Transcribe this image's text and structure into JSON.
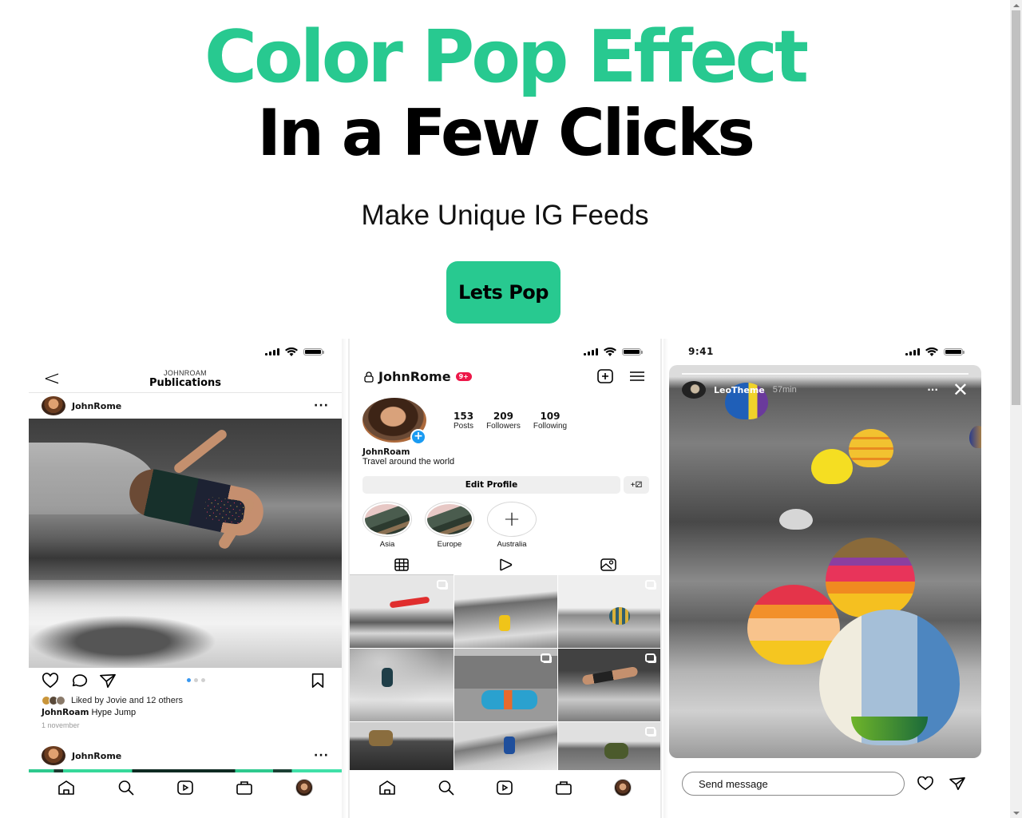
{
  "hero": {
    "title_line1": "Color Pop Effect",
    "title_line2": "In a Few Clicks",
    "subtitle": "Make Unique IG Feeds",
    "cta_label": "Lets Pop"
  },
  "colors": {
    "accent": "#28c990",
    "badge": "#ed1849",
    "add_story": "#1a9bf2",
    "active_dot": "#3897f0"
  },
  "status_bar": {
    "time": "9:41",
    "icons": [
      "signal-icon",
      "wifi-icon",
      "battery-icon"
    ]
  },
  "feed_screen": {
    "nav": {
      "back_icon": "chevron-left-icon",
      "account": "JOHNROAM",
      "title": "Publications"
    },
    "post": {
      "username": "JohnRome",
      "more_icon": "more-horizontal-icon",
      "action_icons": [
        "heart-icon",
        "comment-icon",
        "send-icon",
        "bookmark-icon"
      ],
      "carousel": {
        "count": 3,
        "active": 1
      },
      "liked_by": "Liked by Jovie and 12 others",
      "caption_user": "JohnRoam",
      "caption_text": "Hype Jump",
      "date": "1 november"
    },
    "next_post": {
      "username": "JohnRome"
    }
  },
  "profile_screen": {
    "username": "JohnRome",
    "notification_badge": "9+",
    "header_icons": [
      "lock-icon",
      "add-post-icon",
      "menu-icon"
    ],
    "stats": [
      {
        "value": "153",
        "label": "Posts"
      },
      {
        "value": "209",
        "label": "Followers"
      },
      {
        "value": "109",
        "label": "Following"
      }
    ],
    "bio_name": "JohnRoam",
    "bio_text": "Travel around the world",
    "edit_profile_label": "Edit Profile",
    "add_person_icon": "+⚂",
    "highlights": [
      {
        "label": "Asia"
      },
      {
        "label": "Europe"
      },
      {
        "label": "Australia",
        "is_add": true,
        "icon": "+"
      }
    ],
    "tabs": [
      {
        "icon": "grid-icon",
        "active": true
      },
      {
        "icon": "reels-icon",
        "active": false
      },
      {
        "icon": "tagged-icon",
        "active": false
      }
    ],
    "grid_posts": [
      {
        "subject": "kite surfer",
        "multiple": true
      },
      {
        "subject": "hiker yellow jacket",
        "multiple": false
      },
      {
        "subject": "hot air balloons",
        "multiple": true
      },
      {
        "subject": "surfer in wave",
        "multiple": false
      },
      {
        "subject": "blue classic car",
        "multiple": true
      },
      {
        "subject": "backflip over water",
        "multiple": true
      },
      {
        "subject": "bmx rider",
        "multiple": false
      },
      {
        "subject": "wakeboarder",
        "multiple": false
      },
      {
        "subject": "atv rider",
        "multiple": true
      }
    ]
  },
  "story_screen": {
    "username": "LeoTheme",
    "time_ago": "57min",
    "more_icon": "more-horizontal-icon",
    "close_icon": "✕",
    "message_placeholder": "Send message",
    "action_icons": [
      "heart-icon",
      "send-icon"
    ]
  },
  "bottom_tabs": [
    "home-icon",
    "search-icon",
    "reels-icon",
    "shop-icon",
    "profile-avatar"
  ]
}
